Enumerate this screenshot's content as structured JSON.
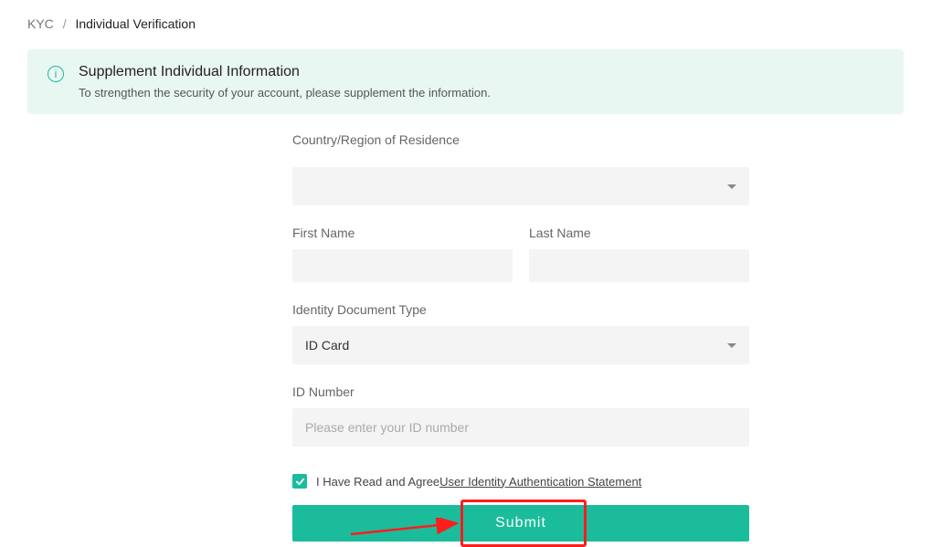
{
  "breadcrumb": {
    "root": "KYC",
    "separator": "/",
    "current": "Individual Verification"
  },
  "banner": {
    "title": "Supplement Individual Information",
    "desc": "To strengthen the security of your account, please supplement the information.",
    "icon": "i"
  },
  "form": {
    "country_label": "Country/Region of Residence",
    "country_value": "",
    "first_name_label": "First Name",
    "first_name_value": "",
    "last_name_label": "Last Name",
    "last_name_value": "",
    "doc_type_label": "Identity Document Type",
    "doc_type_value": "ID Card",
    "id_number_label": "ID Number",
    "id_number_value": "",
    "id_number_placeholder": "Please enter your ID number",
    "agree_text": "I Have Read and Agree",
    "agree_link": "User Identity Authentication Statement",
    "agree_checked": true,
    "submit_label": "Submit"
  },
  "annotation": {
    "highlight_color": "#ff1d1d",
    "arrow_color": "#ff1d1d"
  }
}
